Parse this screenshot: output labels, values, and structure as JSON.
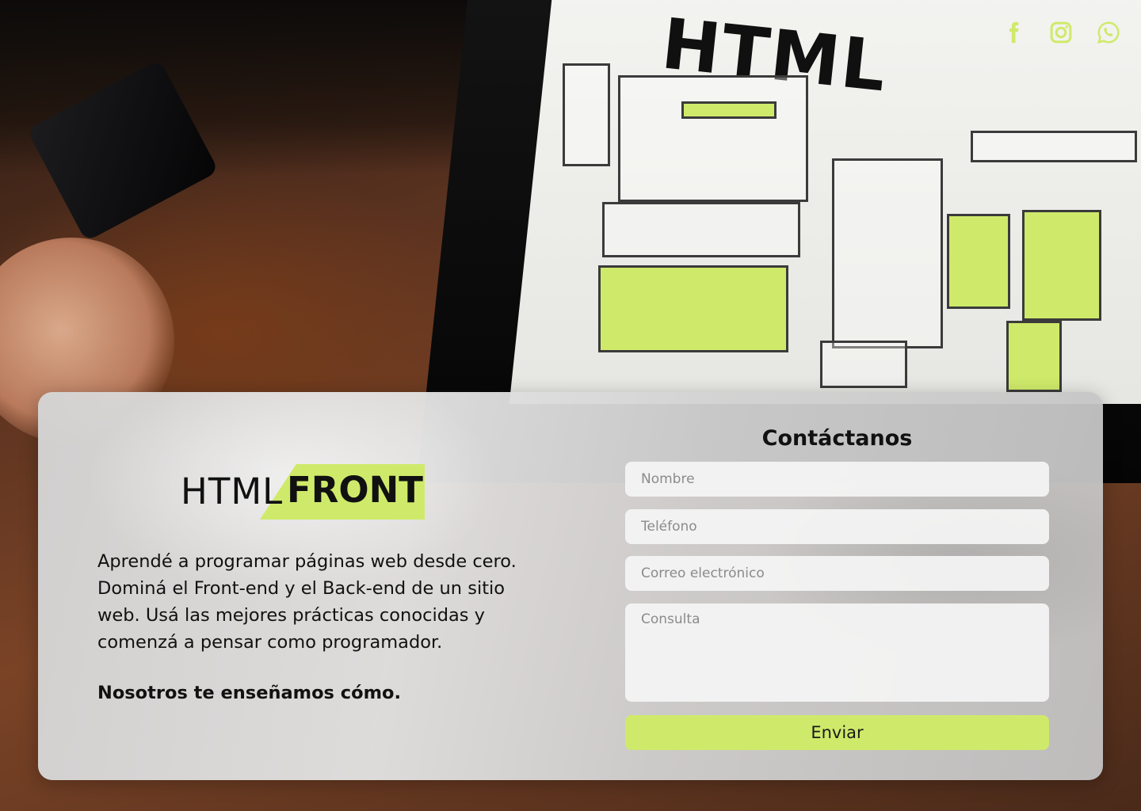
{
  "brand": {
    "part1": "HTML",
    "part2": "FRONT"
  },
  "social": [
    "facebook-icon",
    "instagram-icon",
    "whatsapp-icon"
  ],
  "description": "Aprendé a programar páginas web desde cero. Dominá el Front-end y el Back-end de un sitio web. Usá las mejores prácticas conocidas y comenzá a pensar como programador.",
  "tagline": "Nosotros te enseñamos cómo.",
  "form": {
    "title": "Contáctanos",
    "name_placeholder": "Nombre",
    "phone_placeholder": "Teléfono",
    "email_placeholder": "Correo electrónico",
    "message_placeholder": "Consulta",
    "submit_label": "Enviar"
  },
  "colors": {
    "accent": "#cfea6a",
    "text": "#111111"
  }
}
